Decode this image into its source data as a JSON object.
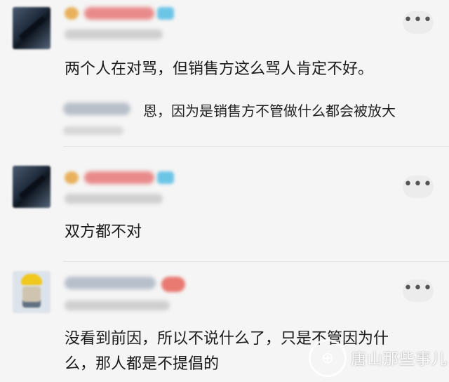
{
  "comments": [
    {
      "avatar": "blurred-user-avatar",
      "more_icon": "•••",
      "text": "两个人在对骂，但销售方这么骂人肯定不好。",
      "reply": {
        "text": "恩，因为是销售方不管做什么都会被放大"
      }
    },
    {
      "avatar": "blurred-user-avatar",
      "more_icon": "•••",
      "text": "双方都不对"
    },
    {
      "avatar": "blurred-cartoon-avatar",
      "more_icon": "•••",
      "text_line1": "没看到前因，所以不说什么了，只是不管因为什",
      "text_line2": "么，那人都是不提倡的"
    }
  ],
  "watermark": {
    "icon": "circle-logo",
    "glyph": "⊕",
    "text": "唐山那些事儿"
  }
}
